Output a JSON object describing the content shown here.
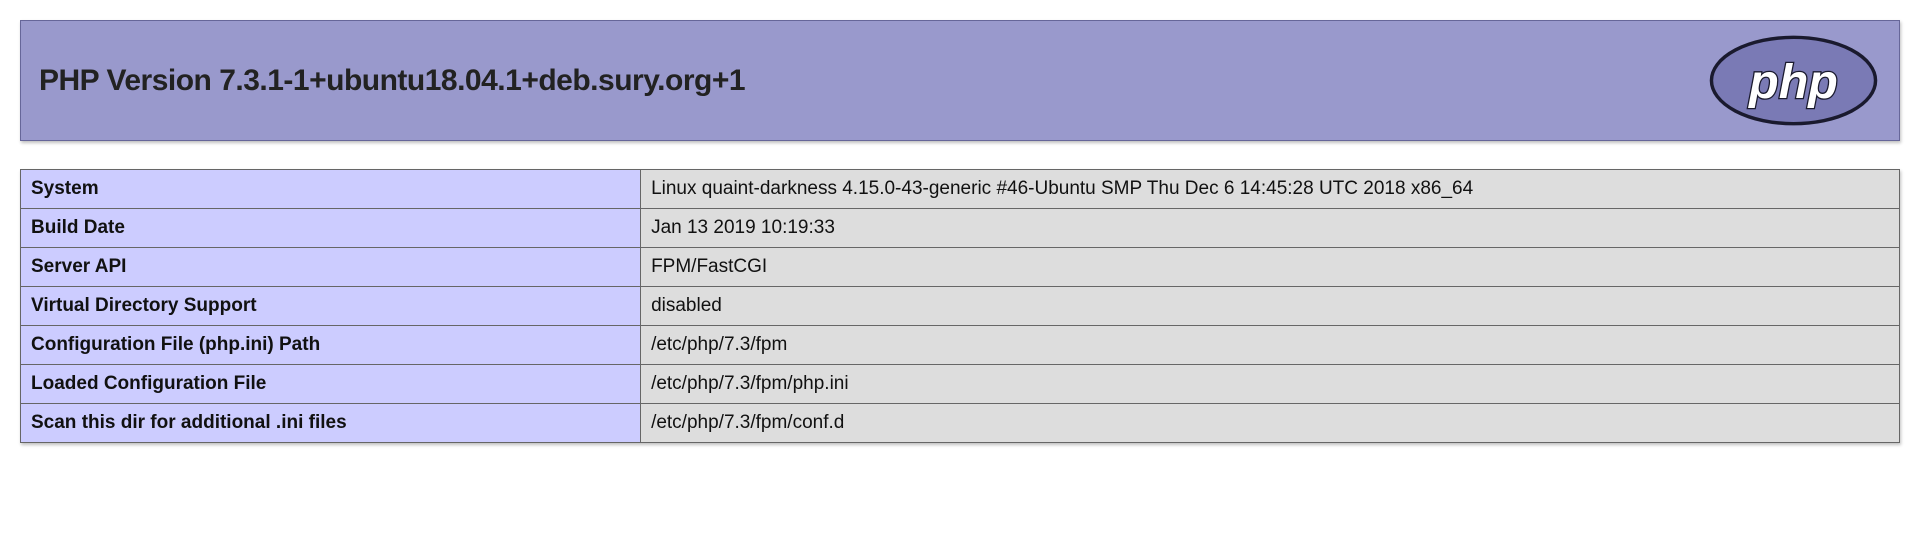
{
  "header": {
    "title": "PHP Version 7.3.1-1+ubuntu18.04.1+deb.sury.org+1"
  },
  "info": {
    "rows": [
      {
        "label": "System",
        "value": "Linux quaint-darkness 4.15.0-43-generic #46-Ubuntu SMP Thu Dec 6 14:45:28 UTC 2018 x86_64"
      },
      {
        "label": "Build Date",
        "value": "Jan 13 2019 10:19:33"
      },
      {
        "label": "Server API",
        "value": "FPM/FastCGI"
      },
      {
        "label": "Virtual Directory Support",
        "value": "disabled"
      },
      {
        "label": "Configuration File (php.ini) Path",
        "value": "/etc/php/7.3/fpm"
      },
      {
        "label": "Loaded Configuration File",
        "value": "/etc/php/7.3/fpm/php.ini"
      },
      {
        "label": "Scan this dir for additional .ini files",
        "value": "/etc/php/7.3/fpm/conf.d"
      }
    ]
  }
}
